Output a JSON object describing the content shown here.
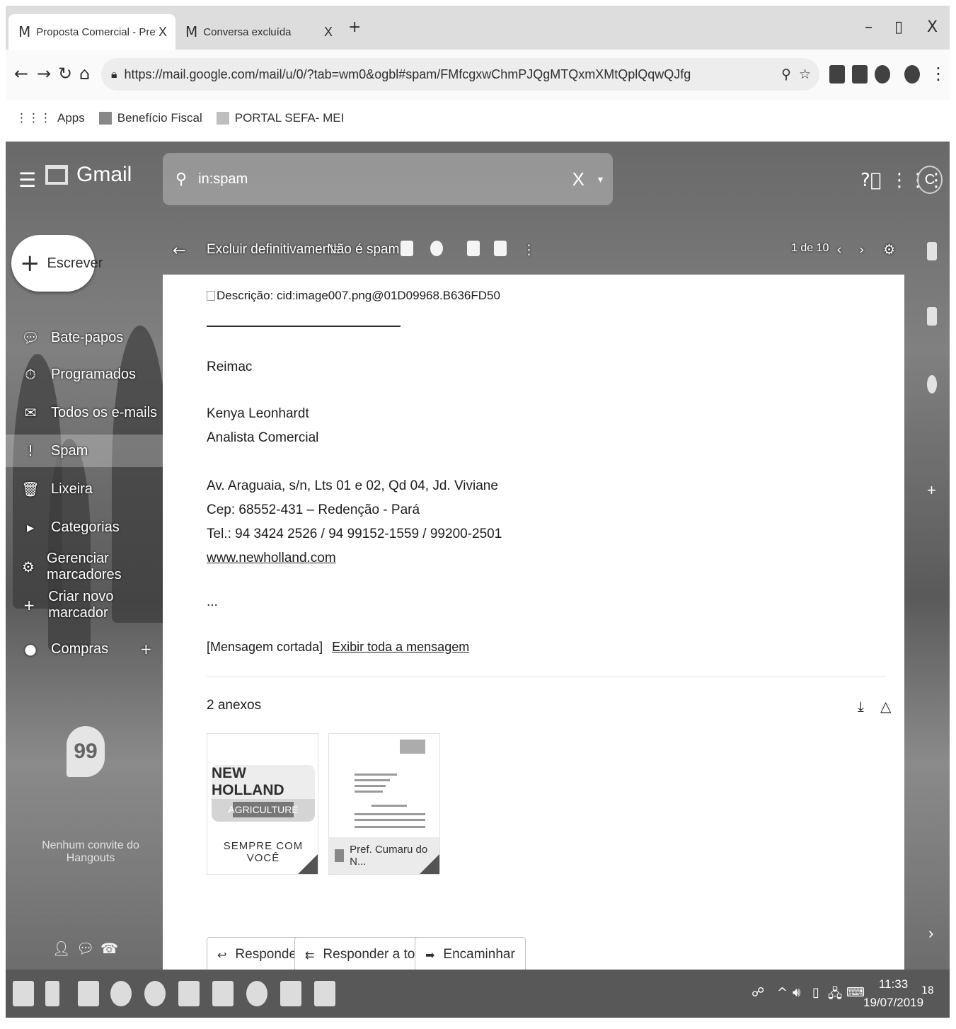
{
  "browser": {
    "tabs": [
      {
        "icon": "M",
        "title": "Proposta Comercial - Pref. Munic",
        "close": "X"
      },
      {
        "icon": "M",
        "title": "Conversa excluída",
        "close": "X"
      }
    ],
    "new_tab": "+",
    "window_controls": {
      "minimize": "–",
      "maximize": "▯",
      "close": "X"
    },
    "url": "https://mail.google.com/mail/u/0/?tab=wm0&ogbl#spam/FMfcgxwChmPJQgMTQxmXMtQplQqwQJfg",
    "bookmarks": [
      "Apps",
      "Benefício Fiscal",
      "PORTAL SEFA- MEI"
    ]
  },
  "gmail": {
    "logo_text": "Gmail",
    "search_value": "in:spam",
    "compose_label": "Escrever",
    "nav": [
      {
        "label": "Bate-papos",
        "icon": "chat-icon"
      },
      {
        "label": "Programados",
        "icon": "scheduled-icon"
      },
      {
        "label": "Todos os e-mails",
        "icon": "all-mail-icon"
      },
      {
        "label": "Spam",
        "icon": "spam-icon",
        "selected": true
      },
      {
        "label": "Lixeira",
        "icon": "trash-icon"
      },
      {
        "label": "Categorias",
        "icon": "category-icon"
      },
      {
        "label": "Gerenciar marcadores",
        "icon": "gear-icon"
      },
      {
        "label": "Criar novo marcador",
        "icon": "plus-icon"
      }
    ],
    "hangouts_user": "Compras",
    "hangouts_empty": "Nenhum convite do Hangouts",
    "actions": {
      "delete_forever": "Excluir definitivamente",
      "not_spam": "Não é spam",
      "pagination": "1 de 10"
    },
    "avatar_letter": "C"
  },
  "message": {
    "image_alt": "Descrição: cid:image007.png@01D09968.B636FD50",
    "company": "Reimac",
    "name": "Kenya Leonhardt",
    "role": "Analista Comercial",
    "address_1": "Av. Araguaia, s/n, Lts 01 e 02, Qd 04, Jd. Viviane",
    "address_2": "Cep: 68552-431 – Redenção - Pará",
    "phone": "Tel.: 94 3424 2526 / 94 99152-1559 / 99200-2501",
    "website": "www.newholland.com",
    "ellipsis": "...",
    "clipped": "[Mensagem cortada]",
    "view_full": "Exibir toda a mensagem",
    "attachments_label": "2 anexos",
    "attachments": [
      {
        "logo_top": "NEW HOLLAND",
        "logo_bottom": "AGRICULTURE",
        "slogan": "SEMPRE COM VOCÊ"
      },
      {
        "name": "Pref. Cumaru do N..."
      }
    ],
    "reply": "Responder",
    "reply_all": "Responder a todos",
    "forward": "Encaminhar"
  },
  "taskbar": {
    "time": "11:33",
    "date": "19/07/2019",
    "notifications": "18"
  }
}
